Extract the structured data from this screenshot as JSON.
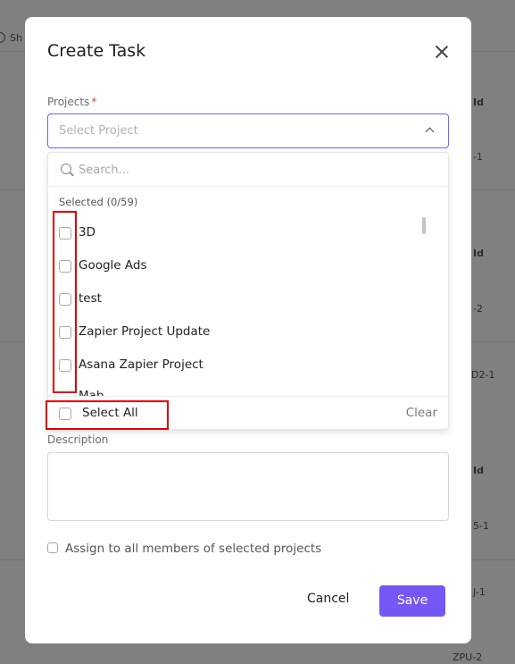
{
  "background": {
    "top_left_text": "Sh",
    "right_labels": [
      "Id",
      "-1",
      "Id",
      "-2",
      "D2-1",
      "Id",
      "5-1",
      "J-1",
      "ZPU-2"
    ]
  },
  "modal": {
    "title": "Create Task",
    "projects_label": "Projects",
    "required_marker": "*",
    "select_placeholder": "Select Project",
    "dropdown": {
      "search_placeholder": "Search...",
      "selected_count": "Selected (0/59)",
      "options": [
        "3D",
        "Google Ads",
        "test",
        "Zapier Project Update",
        "Asana Zapier Project"
      ],
      "partial_option": "Mab",
      "select_all_label": "Select All",
      "clear_label": "Clear"
    },
    "description_label": "Description",
    "description_value": "",
    "assign_label": "Assign to all members of selected projects",
    "cancel_label": "Cancel",
    "save_label": "Save"
  },
  "colors": {
    "accent": "#7557f6",
    "highlight": "#e00000",
    "required": "#e04040"
  }
}
